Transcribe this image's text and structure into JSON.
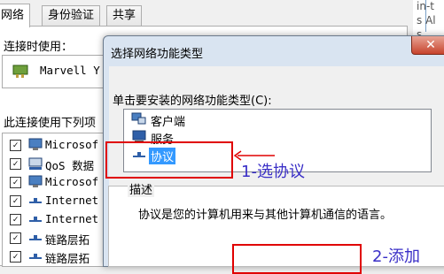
{
  "background_dialog": {
    "tabs": [
      "网络",
      "身份验证",
      "共享"
    ],
    "connect_using_label": "连接时使用：",
    "adapter_name": "Marvell Y",
    "items_label": "此连接使用下列项",
    "items": [
      {
        "checked": true,
        "icon": "network-client-icon",
        "label": "Microsof"
      },
      {
        "checked": true,
        "icon": "qos-icon",
        "label": "QoS 数据"
      },
      {
        "checked": true,
        "icon": "network-client-icon",
        "label": "Microsof"
      },
      {
        "checked": true,
        "icon": "protocol-icon",
        "label": "Internet"
      },
      {
        "checked": true,
        "icon": "protocol-icon",
        "label": "Internet"
      },
      {
        "checked": true,
        "icon": "protocol-icon",
        "label": "链路层拓"
      },
      {
        "checked": true,
        "icon": "protocol-icon",
        "label": "链路层拓"
      }
    ],
    "right_edge_text": [
      "in-t",
      "s Al",
      "s"
    ]
  },
  "dialog": {
    "title": "选择网络功能类型",
    "close_label": "✕",
    "type_label": "单击要安装的网络功能类型(C):",
    "types": [
      {
        "label": "客户端",
        "icon": "client-icon",
        "selected": false
      },
      {
        "label": "服务",
        "icon": "service-icon",
        "selected": false
      },
      {
        "label": "协议",
        "icon": "protocol-icon",
        "selected": true
      }
    ],
    "description_legend": "描述",
    "description_text": "协议是您的计算机用来与其他计算机通信的语言。"
  },
  "annotations": {
    "step1": "1-选协议",
    "step2": "2-添加",
    "highlight_color": "#e00000",
    "text_color": "#3a2fc7"
  }
}
